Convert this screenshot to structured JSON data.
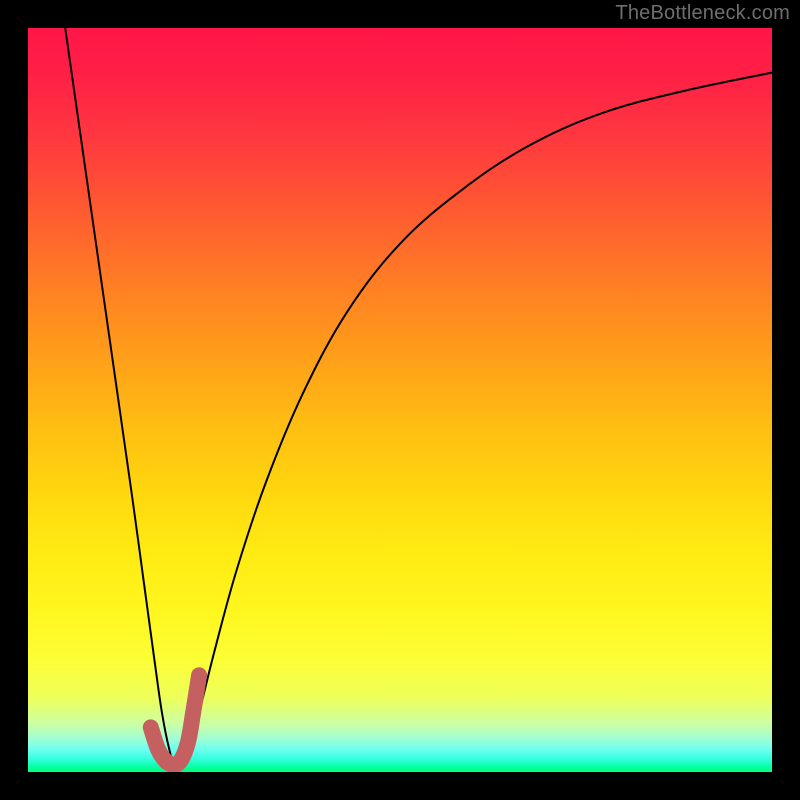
{
  "watermark": "TheBottleneck.com",
  "chart_data": {
    "type": "line",
    "title": "",
    "xlabel": "",
    "ylabel": "",
    "xlim": [
      0,
      100
    ],
    "ylim": [
      0,
      100
    ],
    "grid": false,
    "series": [
      {
        "name": "bottleneck-curve",
        "color": "#000000",
        "stroke_width": 2,
        "x": [
          5,
          8,
          11,
          14,
          15.5,
          17,
          18,
          19,
          20,
          21.5,
          23,
          25,
          28,
          32,
          37,
          43,
          50,
          58,
          67,
          77,
          88,
          100
        ],
        "values": [
          100,
          79,
          58,
          37,
          26,
          15,
          8,
          3,
          0,
          3,
          8,
          16,
          27,
          39,
          51,
          62,
          71,
          78,
          84,
          88.5,
          91.5,
          94
        ]
      },
      {
        "name": "highlight-valley",
        "color": "#c46060",
        "stroke_width": 16,
        "x": [
          16.5,
          17.5,
          18.5,
          19.5,
          20.5,
          21.5,
          22.2,
          23.0
        ],
        "values": [
          6,
          3,
          1.5,
          1,
          1.5,
          4,
          8,
          13
        ]
      }
    ],
    "background_gradient": {
      "orientation": "vertical",
      "stops": [
        {
          "pos": 0.0,
          "color": "#ff1648"
        },
        {
          "pos": 0.5,
          "color": "#ffb014"
        },
        {
          "pos": 0.8,
          "color": "#fff820"
        },
        {
          "pos": 1.0,
          "color": "#00ff7a"
        }
      ]
    }
  }
}
